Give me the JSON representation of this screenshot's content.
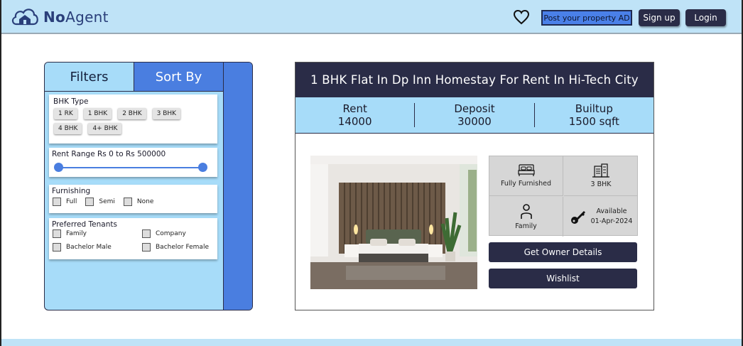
{
  "header": {
    "logo_text_bold": "No",
    "logo_text_rest": "Agent",
    "post_ad_label": "Post your property AD",
    "signup_label": "Sign up",
    "login_label": "Login"
  },
  "filters": {
    "tabs": {
      "filters": "Filters",
      "sort_by": "Sort By"
    },
    "bhk": {
      "title": "BHK Type",
      "options": [
        "1 RK",
        "1 BHK",
        "2 BHK",
        "3 BHK",
        "4 BHK",
        "4+ BHK"
      ]
    },
    "rent": {
      "title": "Rent Range Rs 0 to Rs 500000",
      "min_value": 0,
      "max_value": 500000
    },
    "furnishing": {
      "title": "Furnishing",
      "options": [
        "Full",
        "Semi",
        "None"
      ]
    },
    "tenants": {
      "title": "Preferred Tenants",
      "options": [
        "Family",
        "Company",
        "Bachelor Male",
        "Bachelor Female"
      ]
    }
  },
  "listing": {
    "title": "1 BHK Flat In Dp Inn Homestay For Rent In Hi-Tech City",
    "rent_label": "Rent",
    "rent_value": "14000",
    "deposit_label": "Deposit",
    "deposit_value": "30000",
    "builtup_label": "Builtup",
    "builtup_value": "1500 sqft",
    "features": {
      "furnishing": "Fully Furnished",
      "bhk": "3 BHK",
      "tenant": "Family",
      "available_label": "Available",
      "available_date": "01-Apr-2024"
    },
    "owner_button": "Get Owner Details",
    "wishlist_button": "Wishlist"
  },
  "icons": {
    "logo": "cloud-house-icon",
    "heart": "heart-icon",
    "bed": "bed-icon",
    "building": "building-icon",
    "person": "person-icon",
    "key": "key-icon"
  },
  "colors": {
    "header_bg": "#bfe3f7",
    "navy": "#2a2c47",
    "accent_blue": "#4a7ee0",
    "panel_blue": "#a7dcf9"
  }
}
